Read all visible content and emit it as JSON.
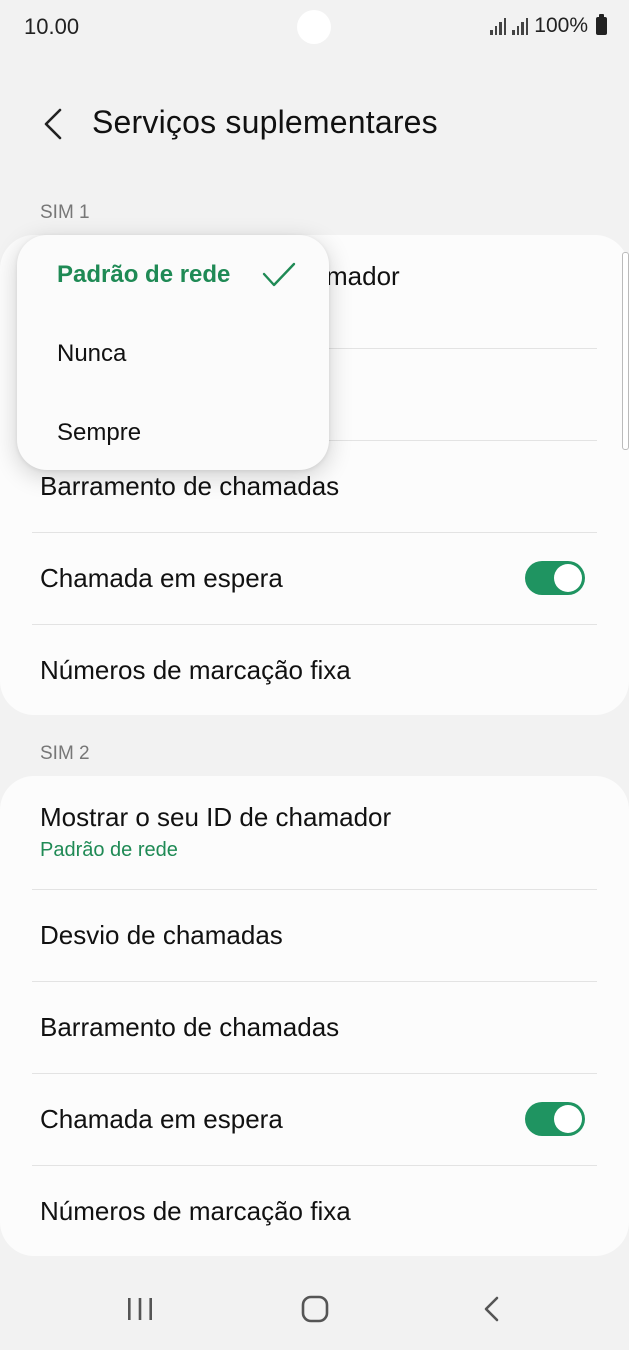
{
  "status_bar": {
    "time": "10.00",
    "battery": "100%"
  },
  "header": {
    "title": "Serviços suplementares"
  },
  "sim1": {
    "label": "SIM 1",
    "caller_id_partial": "mador",
    "items": [
      "Barramento de chamadas",
      "Chamada em espera",
      "Números de marcação fixa"
    ],
    "call_waiting_on": true
  },
  "popup": {
    "options": [
      "Padrão de rede",
      "Nunca",
      "Sempre"
    ],
    "selected": "Padrão de rede"
  },
  "sim2": {
    "label": "SIM 2",
    "caller_id": {
      "title": "Mostrar o seu ID de chamador",
      "value": "Padrão de rede"
    },
    "items": [
      "Desvio de chamadas",
      "Barramento de chamadas",
      "Chamada em espera",
      "Números de marcação fixa"
    ],
    "call_waiting_on": true
  },
  "colors": {
    "accent": "#1f8a55",
    "toggle_on": "#1f9461",
    "background": "#f2f2f2"
  }
}
